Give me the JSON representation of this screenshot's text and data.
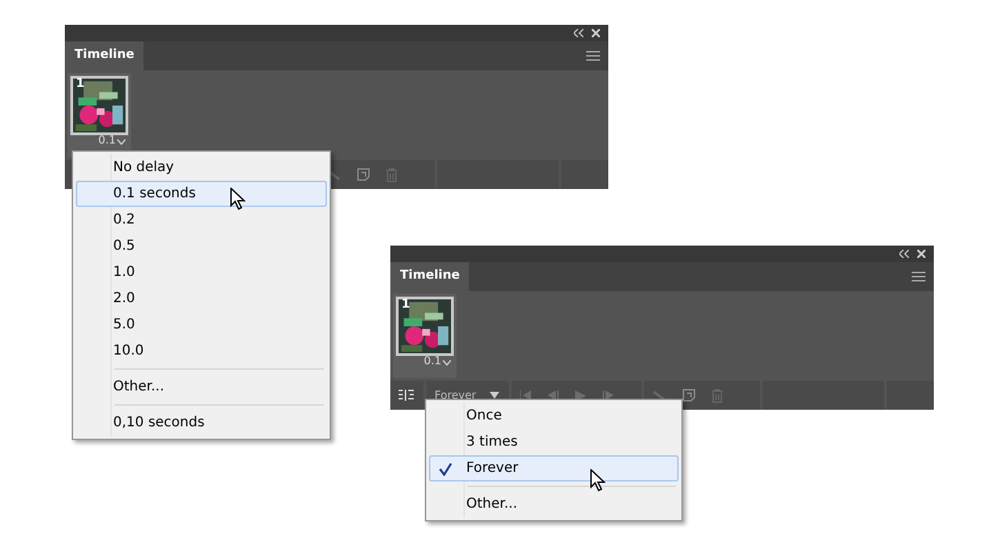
{
  "panels": [
    {
      "tab": "Timeline",
      "frames": [
        {
          "number": "1",
          "delay": "0.1",
          "selected": true
        }
      ],
      "menu": {
        "groups": [
          [
            {
              "label": "No delay",
              "selected": false
            },
            {
              "label": "0.1 seconds",
              "selected": true
            },
            {
              "label": "0.2",
              "selected": false
            },
            {
              "label": "0.5",
              "selected": false
            },
            {
              "label": "1.0",
              "selected": false
            },
            {
              "label": "2.0",
              "selected": false
            },
            {
              "label": "5.0",
              "selected": false
            },
            {
              "label": "10.0",
              "selected": false
            }
          ],
          [
            {
              "label": "Other...",
              "selected": false
            }
          ],
          [
            {
              "label": "0,10 seconds",
              "selected": false
            }
          ]
        ]
      }
    },
    {
      "tab": "Timeline",
      "frames": [
        {
          "number": "1",
          "delay": "0.1",
          "selected": true
        }
      ],
      "loop": "Forever",
      "menu": {
        "groups": [
          [
            {
              "label": "Once",
              "selected": false,
              "checked": false
            },
            {
              "label": "3 times",
              "selected": false,
              "checked": false
            },
            {
              "label": "Forever",
              "selected": true,
              "checked": true
            }
          ],
          [
            {
              "label": "Other...",
              "selected": false,
              "checked": false
            }
          ]
        ]
      }
    }
  ]
}
